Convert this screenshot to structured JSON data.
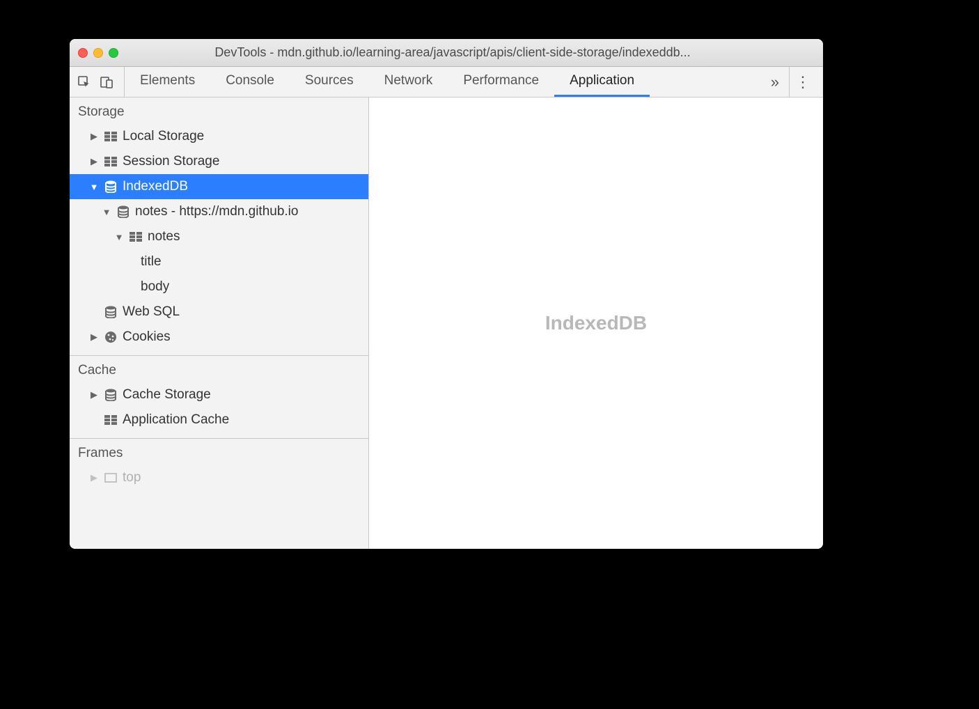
{
  "window": {
    "title": "DevTools - mdn.github.io/learning-area/javascript/apis/client-side-storage/indexeddb..."
  },
  "tabs": {
    "items": [
      "Elements",
      "Console",
      "Sources",
      "Network",
      "Performance",
      "Application"
    ],
    "active": "Application",
    "overflow_glyph": "»",
    "kebab_glyph": "⋮"
  },
  "sidebar": {
    "storage": {
      "header": "Storage",
      "local_storage": "Local Storage",
      "session_storage": "Session Storage",
      "indexeddb": {
        "label": "IndexedDB",
        "db": {
          "label": "notes - https://mdn.github.io",
          "store": {
            "label": "notes",
            "indexes": [
              "title",
              "body"
            ]
          }
        }
      },
      "web_sql": "Web SQL",
      "cookies": "Cookies"
    },
    "cache": {
      "header": "Cache",
      "cache_storage": "Cache Storage",
      "application_cache": "Application Cache"
    },
    "frames": {
      "header": "Frames",
      "top": "top"
    }
  },
  "main": {
    "placeholder": "IndexedDB"
  }
}
